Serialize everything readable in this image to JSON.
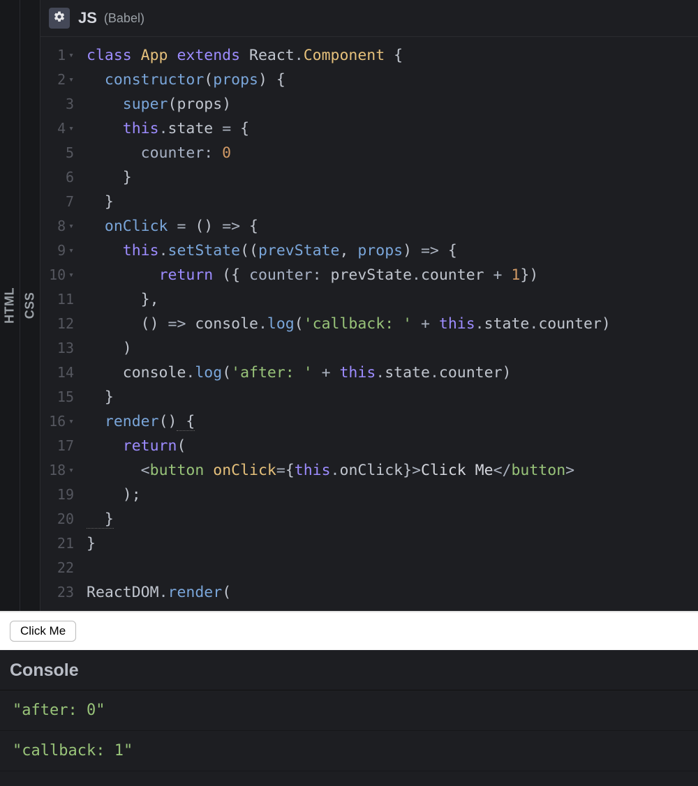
{
  "vtabs": {
    "html": "HTML",
    "css": "CSS"
  },
  "editor": {
    "title": "JS",
    "suffix": "(Babel)",
    "gutter": [
      {
        "n": "1",
        "fold": true
      },
      {
        "n": "2",
        "fold": true
      },
      {
        "n": "3",
        "fold": false
      },
      {
        "n": "4",
        "fold": true
      },
      {
        "n": "5",
        "fold": false
      },
      {
        "n": "6",
        "fold": false
      },
      {
        "n": "7",
        "fold": false
      },
      {
        "n": "8",
        "fold": true
      },
      {
        "n": "9",
        "fold": true
      },
      {
        "n": "10",
        "fold": true
      },
      {
        "n": "11",
        "fold": false
      },
      {
        "n": "12",
        "fold": false
      },
      {
        "n": "13",
        "fold": false
      },
      {
        "n": "14",
        "fold": false
      },
      {
        "n": "15",
        "fold": false
      },
      {
        "n": "16",
        "fold": true
      },
      {
        "n": "17",
        "fold": false
      },
      {
        "n": "18",
        "fold": true
      },
      {
        "n": "19",
        "fold": false
      },
      {
        "n": "20",
        "fold": false
      },
      {
        "n": "21",
        "fold": false
      },
      {
        "n": "22",
        "fold": false
      },
      {
        "n": "23",
        "fold": false
      }
    ],
    "code": [
      [
        {
          "c": "t-kw",
          "t": "class "
        },
        {
          "c": "t-cls",
          "t": "App"
        },
        {
          "c": "t-kw",
          "t": " extends "
        },
        {
          "c": "t-var",
          "t": "React"
        },
        {
          "c": "t-op",
          "t": "."
        },
        {
          "c": "t-cls",
          "t": "Component"
        },
        {
          "c": "t-pun",
          "t": " {"
        }
      ],
      [
        {
          "c": "t-pun",
          "t": "  "
        },
        {
          "c": "t-def",
          "t": "constructor"
        },
        {
          "c": "t-pun",
          "t": "("
        },
        {
          "c": "t-def",
          "t": "props"
        },
        {
          "c": "t-pun",
          "t": ") {"
        }
      ],
      [
        {
          "c": "t-pun",
          "t": "    "
        },
        {
          "c": "t-fn",
          "t": "super"
        },
        {
          "c": "t-pun",
          "t": "("
        },
        {
          "c": "t-var",
          "t": "props"
        },
        {
          "c": "t-pun",
          "t": ")"
        }
      ],
      [
        {
          "c": "t-pun",
          "t": "    "
        },
        {
          "c": "t-kw",
          "t": "this"
        },
        {
          "c": "t-op",
          "t": "."
        },
        {
          "c": "t-prop",
          "t": "state"
        },
        {
          "c": "t-op",
          "t": " = "
        },
        {
          "c": "t-pun",
          "t": "{"
        }
      ],
      [
        {
          "c": "t-pun",
          "t": "      "
        },
        {
          "c": "t-prop2",
          "t": "counter"
        },
        {
          "c": "t-op",
          "t": ": "
        },
        {
          "c": "t-num",
          "t": "0"
        }
      ],
      [
        {
          "c": "t-pun",
          "t": "    }"
        }
      ],
      [
        {
          "c": "t-pun",
          "t": "  }"
        }
      ],
      [
        {
          "c": "t-pun",
          "t": "  "
        },
        {
          "c": "t-def",
          "t": "onClick"
        },
        {
          "c": "t-op",
          "t": " = "
        },
        {
          "c": "t-pun",
          "t": "() "
        },
        {
          "c": "t-op",
          "t": "=>"
        },
        {
          "c": "t-pun",
          "t": " {"
        }
      ],
      [
        {
          "c": "t-pun",
          "t": "    "
        },
        {
          "c": "t-kw",
          "t": "this"
        },
        {
          "c": "t-op",
          "t": "."
        },
        {
          "c": "t-fn",
          "t": "setState"
        },
        {
          "c": "t-pun",
          "t": "(("
        },
        {
          "c": "t-def",
          "t": "prevState"
        },
        {
          "c": "t-pun",
          "t": ", "
        },
        {
          "c": "t-def",
          "t": "props"
        },
        {
          "c": "t-pun",
          "t": ") "
        },
        {
          "c": "t-op",
          "t": "=>"
        },
        {
          "c": "t-pun",
          "t": " {"
        }
      ],
      [
        {
          "c": "t-pun",
          "t": "        "
        },
        {
          "c": "t-kw",
          "t": "return"
        },
        {
          "c": "t-pun",
          "t": " ({ "
        },
        {
          "c": "t-prop2",
          "t": "counter"
        },
        {
          "c": "t-op",
          "t": ": "
        },
        {
          "c": "t-var",
          "t": "prevState"
        },
        {
          "c": "t-op",
          "t": "."
        },
        {
          "c": "t-prop",
          "t": "counter"
        },
        {
          "c": "t-op",
          "t": " + "
        },
        {
          "c": "t-num",
          "t": "1"
        },
        {
          "c": "t-pun",
          "t": "})"
        }
      ],
      [
        {
          "c": "t-pun",
          "t": "      },"
        }
      ],
      [
        {
          "c": "t-pun",
          "t": "      () "
        },
        {
          "c": "t-op",
          "t": "=>"
        },
        {
          "c": "t-pun",
          "t": " "
        },
        {
          "c": "t-var",
          "t": "console"
        },
        {
          "c": "t-op",
          "t": "."
        },
        {
          "c": "t-fn",
          "t": "log"
        },
        {
          "c": "t-pun",
          "t": "("
        },
        {
          "c": "t-str",
          "t": "'callback: '"
        },
        {
          "c": "t-op",
          "t": " + "
        },
        {
          "c": "t-kw",
          "t": "this"
        },
        {
          "c": "t-op",
          "t": "."
        },
        {
          "c": "t-prop",
          "t": "state"
        },
        {
          "c": "t-op",
          "t": "."
        },
        {
          "c": "t-prop",
          "t": "counter"
        },
        {
          "c": "t-pun",
          "t": ")"
        }
      ],
      [
        {
          "c": "t-pun",
          "t": "    )"
        }
      ],
      [
        {
          "c": "t-pun",
          "t": "    "
        },
        {
          "c": "t-var",
          "t": "console"
        },
        {
          "c": "t-op",
          "t": "."
        },
        {
          "c": "t-fn",
          "t": "log"
        },
        {
          "c": "t-pun",
          "t": "("
        },
        {
          "c": "t-str",
          "t": "'after: '"
        },
        {
          "c": "t-op",
          "t": " + "
        },
        {
          "c": "t-kw",
          "t": "this"
        },
        {
          "c": "t-op",
          "t": "."
        },
        {
          "c": "t-prop",
          "t": "state"
        },
        {
          "c": "t-op",
          "t": "."
        },
        {
          "c": "t-prop",
          "t": "counter"
        },
        {
          "c": "t-pun",
          "t": ")"
        }
      ],
      [
        {
          "c": "t-pun",
          "t": "  }"
        }
      ],
      [
        {
          "c": "t-pun",
          "t": "  "
        },
        {
          "c": "t-def",
          "t": "render"
        },
        {
          "c": "t-pun",
          "t": "()"
        },
        {
          "c": "t-pun under",
          "t": " {"
        }
      ],
      [
        {
          "c": "t-pun",
          "t": "    "
        },
        {
          "c": "t-kw",
          "t": "return"
        },
        {
          "c": "t-pun",
          "t": "("
        }
      ],
      [
        {
          "c": "t-pun",
          "t": "      "
        },
        {
          "c": "t-op",
          "t": "<"
        },
        {
          "c": "t-tag",
          "t": "button"
        },
        {
          "c": "t-pun",
          "t": " "
        },
        {
          "c": "t-cls",
          "t": "onClick"
        },
        {
          "c": "t-op",
          "t": "="
        },
        {
          "c": "t-pun",
          "t": "{"
        },
        {
          "c": "t-kw",
          "t": "this"
        },
        {
          "c": "t-op",
          "t": "."
        },
        {
          "c": "t-prop",
          "t": "onClick"
        },
        {
          "c": "t-pun",
          "t": "}"
        },
        {
          "c": "t-op",
          "t": ">"
        },
        {
          "c": "t-txt",
          "t": "Click Me"
        },
        {
          "c": "t-op",
          "t": "</"
        },
        {
          "c": "t-tag",
          "t": "button"
        },
        {
          "c": "t-op",
          "t": ">"
        }
      ],
      [
        {
          "c": "t-pun",
          "t": "    );"
        }
      ],
      [
        {
          "c": "t-pun under",
          "t": "  }"
        }
      ],
      [
        {
          "c": "t-pun",
          "t": "}"
        }
      ],
      [
        {
          "c": "t-pun",
          "t": ""
        }
      ],
      [
        {
          "c": "t-var",
          "t": "ReactDOM"
        },
        {
          "c": "t-op",
          "t": "."
        },
        {
          "c": "t-fn",
          "t": "render"
        },
        {
          "c": "t-pun",
          "t": "("
        }
      ]
    ]
  },
  "preview": {
    "button_label": "Click Me"
  },
  "console": {
    "title": "Console",
    "logs": [
      "\"after: 0\"",
      "\"callback: 1\""
    ]
  }
}
